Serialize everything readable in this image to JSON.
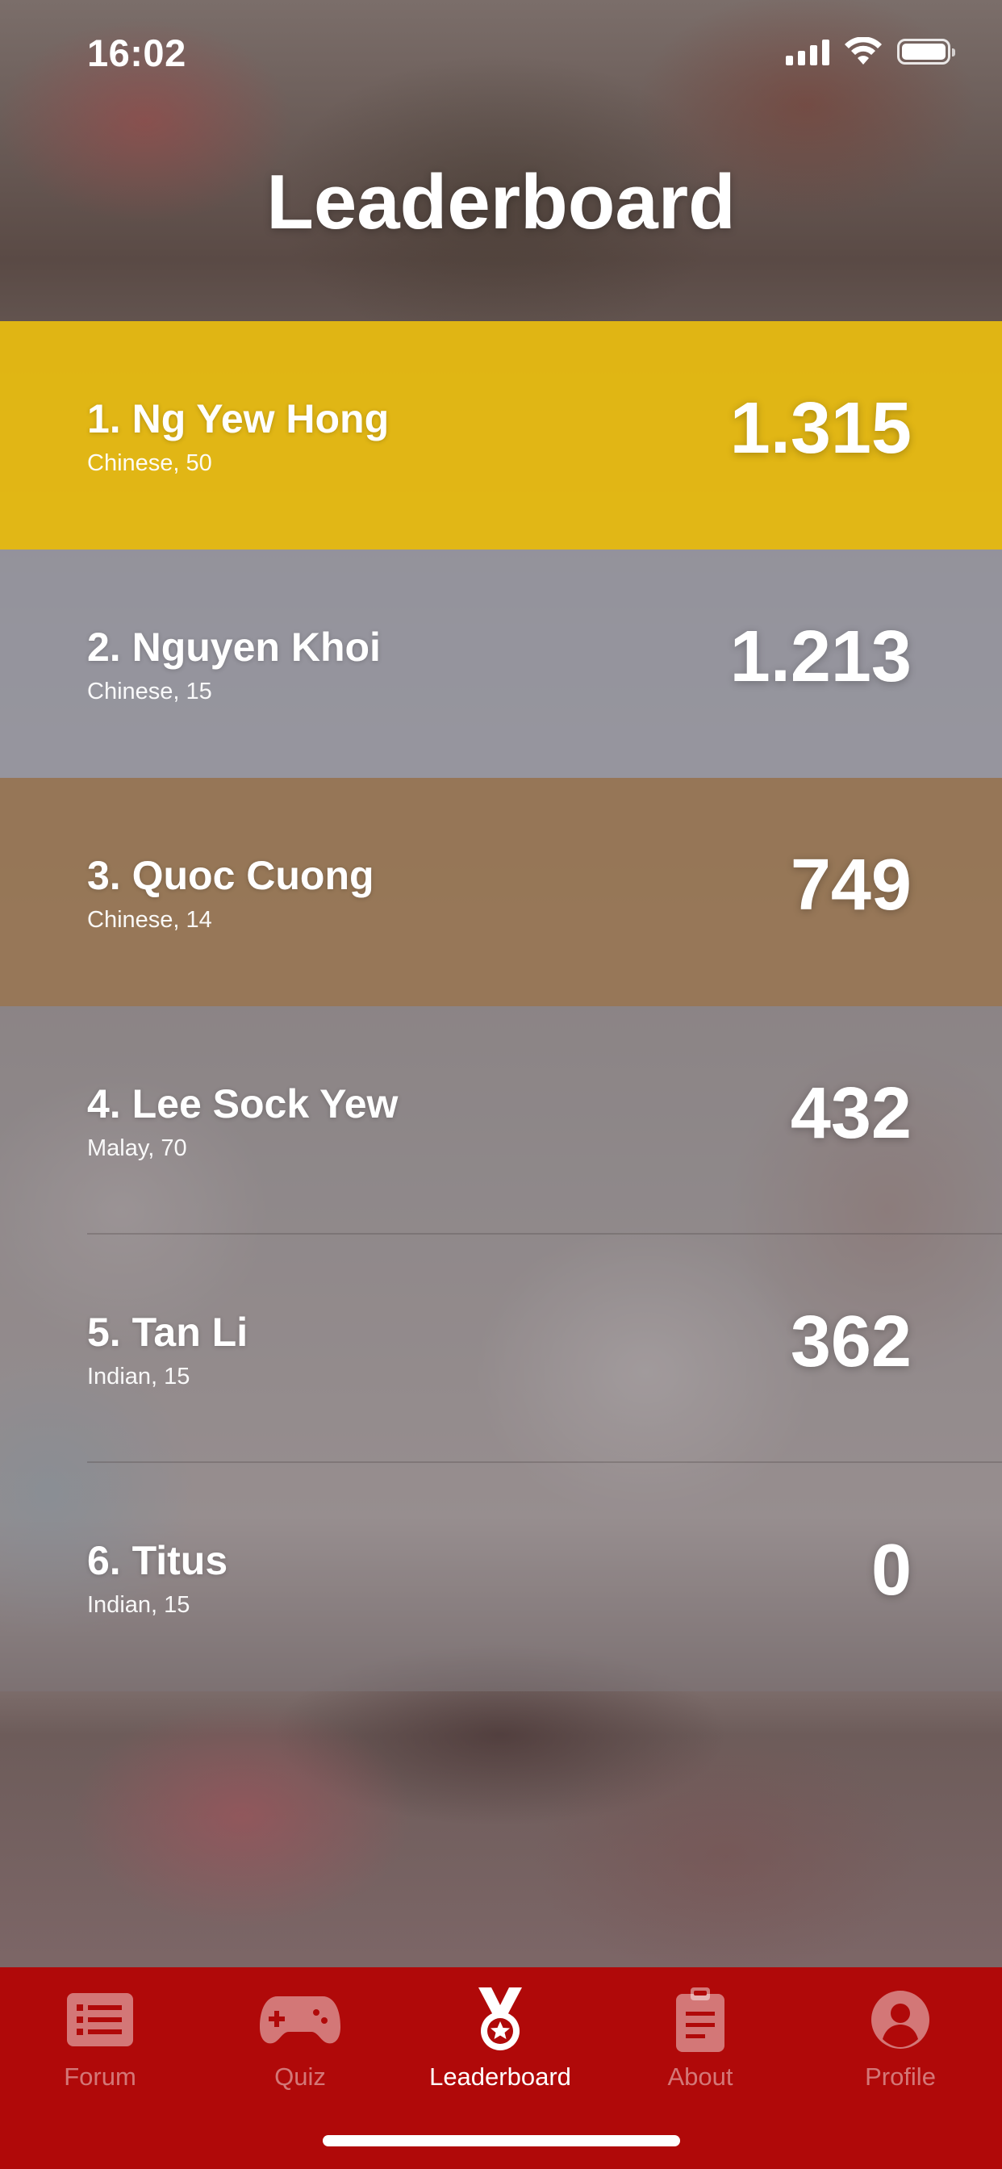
{
  "status_bar": {
    "time": "16:02",
    "icons": [
      "signal-icon",
      "wifi-icon",
      "battery-icon"
    ]
  },
  "title": "Leaderboard",
  "colors": {
    "gold": "#E7BB11",
    "silver": "#9696A0",
    "bronze": "#967350",
    "tab_bar": "#B00909"
  },
  "leaderboard": [
    {
      "name": "1. Ng Yew Hong",
      "meta": "Chinese, 50",
      "score": "1.315"
    },
    {
      "name": "2. Nguyen Khoi",
      "meta": "Chinese, 15",
      "score": "1.213"
    },
    {
      "name": "3. Quoc Cuong",
      "meta": "Chinese, 14",
      "score": "749"
    },
    {
      "name": "4. Lee Sock Yew",
      "meta": "Malay, 70",
      "score": "432"
    },
    {
      "name": "5. Tan Li",
      "meta": "Indian, 15",
      "score": "362"
    },
    {
      "name": "6. Titus",
      "meta": "Indian, 15",
      "score": "0"
    }
  ],
  "tabs": [
    {
      "label": "Forum",
      "icon": "list-icon",
      "active": false
    },
    {
      "label": "Quiz",
      "icon": "gamepad-icon",
      "active": false
    },
    {
      "label": "Leaderboard",
      "icon": "medal-icon",
      "active": true
    },
    {
      "label": "About",
      "icon": "clipboard-icon",
      "active": false
    },
    {
      "label": "Profile",
      "icon": "user-icon",
      "active": false
    }
  ]
}
